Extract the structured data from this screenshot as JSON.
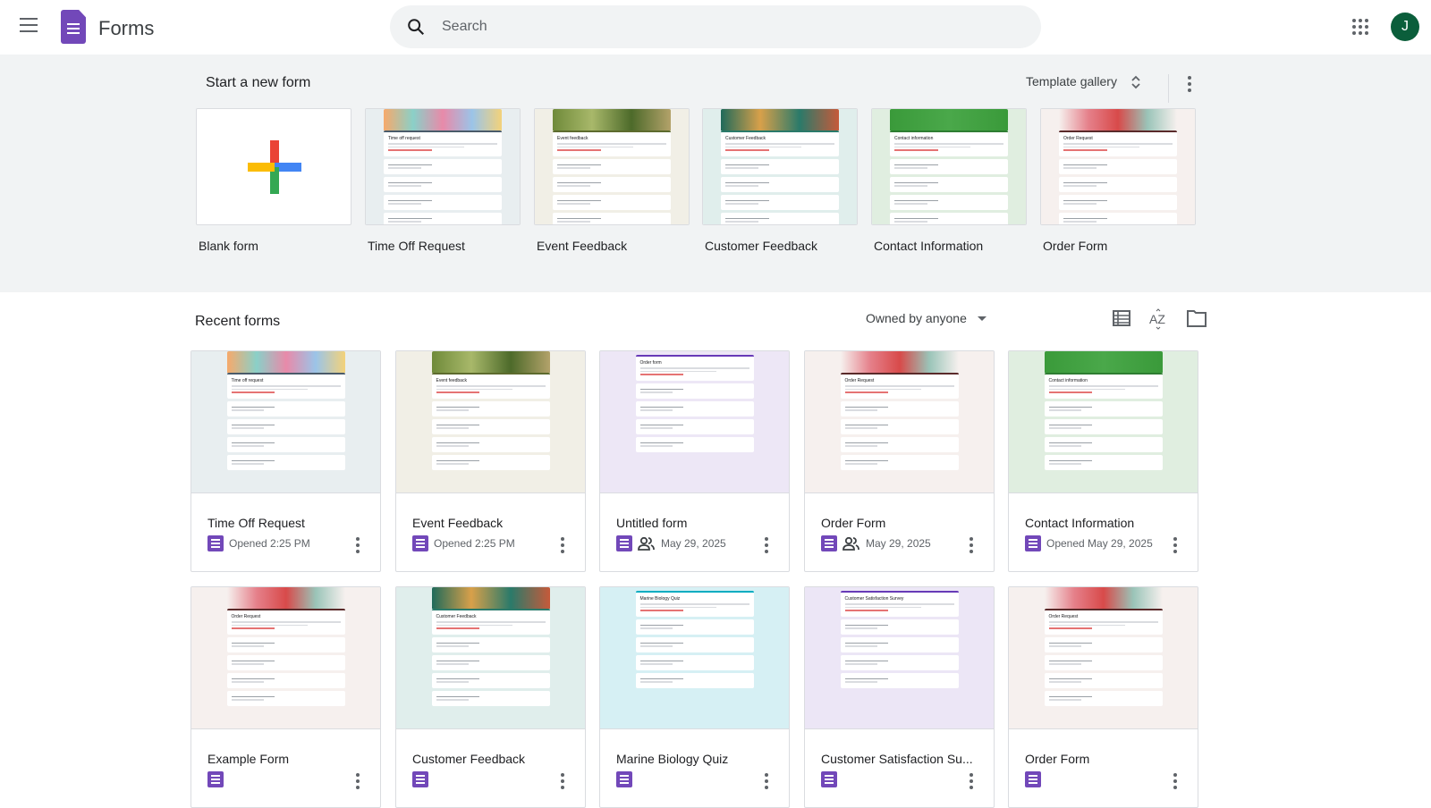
{
  "app": {
    "title": "Forms",
    "menu_icon": "hamburger-icon",
    "avatar_letter": "J",
    "brand_color": "#7248b9"
  },
  "search": {
    "placeholder": "Search"
  },
  "templates": {
    "heading": "Start a new form",
    "gallery_label": "Template gallery",
    "items": [
      {
        "label": "Blank form"
      },
      {
        "label": "Time Off Request",
        "bg": "#e8eef0",
        "banner": "linear-gradient(90deg,#f7a96b,#8ad0c8,#e88aa9,#9bc4e8,#f3d27a)",
        "accent": "#4a5b6a",
        "title": "Time off request"
      },
      {
        "label": "Event Feedback",
        "bg": "#f1efe6",
        "banner": "linear-gradient(90deg,#6f8a3a,#a8b86a,#4d6a2a,#b3a26a)",
        "accent": "#5d6b2e",
        "title": "Event feedback"
      },
      {
        "label": "Customer Feedback",
        "bg": "#e0eeec",
        "banner": "linear-gradient(90deg,#1f6a5a,#d8a04a,#2a7a6a,#c65a3a)",
        "accent": "#2a7a6a",
        "title": "Customer Feedback"
      },
      {
        "label": "Contact Information",
        "bg": "#e0eee0",
        "banner": "linear-gradient(90deg,#3a9a3a,#4aa84a,#3a9a3a)",
        "accent": "#2e7d32",
        "title": "Contact information"
      },
      {
        "label": "Order Form",
        "bg": "#f6f0ee",
        "banner": "linear-gradient(90deg,#f6f0ee,#e5808a,#d84a4a,#9ac4b8,#f6f0ee)",
        "accent": "#5a2a2a",
        "title": "Order Request"
      }
    ]
  },
  "recent": {
    "heading": "Recent forms",
    "owner_filter": "Owned by anyone",
    "tools": [
      "list-view-icon",
      "sort-az-icon",
      "folder-icon"
    ],
    "items": [
      {
        "name": "Time Off Request",
        "meta": "Opened 2:25 PM",
        "shared": false,
        "bg": "#e8eef0",
        "banner": "linear-gradient(90deg,#f7a96b,#8ad0c8,#e88aa9,#9bc4e8,#f3d27a)",
        "accent": "#4a5b6a",
        "title": "Time off request"
      },
      {
        "name": "Event Feedback",
        "meta": "Opened 2:25 PM",
        "shared": false,
        "bg": "#f1efe6",
        "banner": "linear-gradient(90deg,#6f8a3a,#a8b86a,#4d6a2a,#b3a26a)",
        "accent": "#5d6b2e",
        "title": "Event feedback"
      },
      {
        "name": "Untitled form",
        "meta": "May 29, 2025",
        "shared": true,
        "bg": "#ede7f6",
        "banner": "",
        "accent": "#673ab7",
        "title": "Order form"
      },
      {
        "name": "Order Form",
        "meta": "May 29, 2025",
        "shared": true,
        "bg": "#f6f0ee",
        "banner": "linear-gradient(90deg,#f6f0ee,#e5808a,#d84a4a,#9ac4b8,#f6f0ee)",
        "accent": "#5a2a2a",
        "title": "Order Request"
      },
      {
        "name": "Contact Information",
        "meta": "Opened May 29, 2025",
        "shared": false,
        "bg": "#e0eee0",
        "banner": "linear-gradient(90deg,#3a9a3a,#4aa84a,#3a9a3a)",
        "accent": "#2e7d32",
        "title": "Contact information"
      },
      {
        "name": "Example Form",
        "meta": "",
        "shared": false,
        "bg": "#f6f0ee",
        "banner": "linear-gradient(90deg,#f6f0ee,#e5808a,#d84a4a,#9ac4b8,#f6f0ee)",
        "accent": "#5a2a2a",
        "title": "Order Request"
      },
      {
        "name": "Customer Feedback",
        "meta": "",
        "shared": false,
        "bg": "#e0eeec",
        "banner": "linear-gradient(90deg,#1f6a5a,#d8a04a,#2a7a6a,#c65a3a)",
        "accent": "#2a7a6a",
        "title": "Customer Feedback"
      },
      {
        "name": "Marine Biology Quiz",
        "meta": "",
        "shared": false,
        "bg": "#d6f0f4",
        "banner": "",
        "accent": "#00acc1",
        "title": "Marine Biology Quiz"
      },
      {
        "name": "Customer Satisfaction Su...",
        "meta": "",
        "shared": false,
        "bg": "#ece6f6",
        "banner": "",
        "accent": "#673ab7",
        "title": "Customer Satisfaction Survey"
      },
      {
        "name": "Order Form",
        "meta": "",
        "shared": false,
        "bg": "#f6f0ee",
        "banner": "linear-gradient(90deg,#f6f0ee,#e5808a,#d84a4a,#9ac4b8,#f6f0ee)",
        "accent": "#5a2a2a",
        "title": "Order Request"
      }
    ]
  }
}
